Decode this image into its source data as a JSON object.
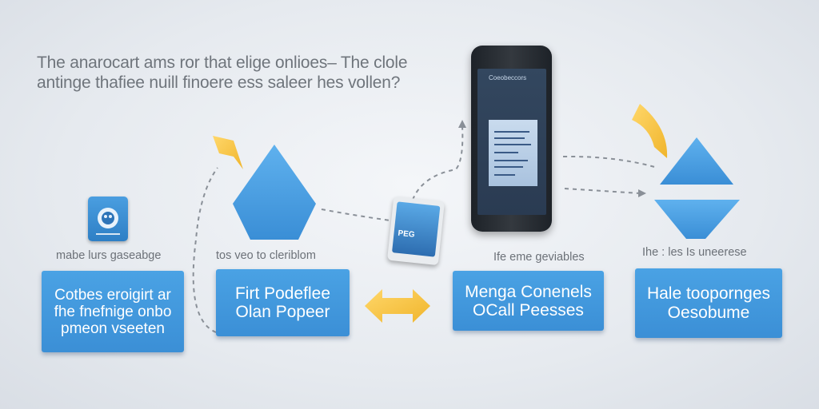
{
  "headline": [
    "The anarocart ams ror that elige onlioes– The clole",
    "antinge thafiee nuill finoere ess saleer hes vollen?"
  ],
  "captions": {
    "c1": "mabe lurs gaseabge",
    "c2": "tos veo to cleriblom",
    "c3": "Ife eme geviables",
    "c4": "Ihe : les Is uneerese"
  },
  "boxes": {
    "b1": [
      "Cotbes eroigirt ar",
      "fhe fnefnige onbo",
      "pmeon vseeten"
    ],
    "b2": [
      "Firt Podeflee",
      "Olan Popeer"
    ],
    "b3": [
      "Menga Conenels",
      "OCall Peesses"
    ],
    "b4": [
      "Hale toopornges",
      "Oesobume"
    ]
  },
  "device": {
    "screen_title": "Coeobeccors",
    "tablet_label": "PEG"
  },
  "icons": [
    "app-icon",
    "diamond-shape",
    "triangle-shape",
    "phone",
    "tablet",
    "curved-arrow-icon",
    "double-arrow-icon",
    "dashed-connector"
  ],
  "colors": {
    "box": "#3d92d8",
    "shape": "#4aa0e2",
    "arrow": "#f5c542",
    "text": "#6c7178",
    "connector": "#8a9098"
  }
}
